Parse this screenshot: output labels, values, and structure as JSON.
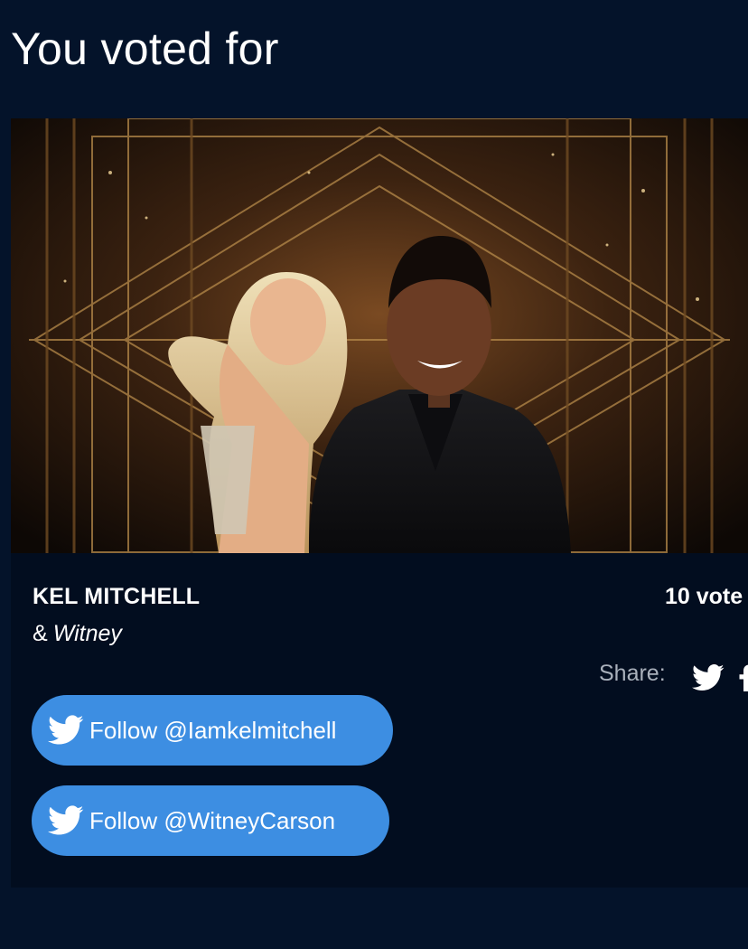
{
  "heading": "You voted for",
  "couple": {
    "celebrity_name": "KEL MITCHELL",
    "amp": "&",
    "partner_name": "Witney",
    "votes_label": "10 vote"
  },
  "share": {
    "label": "Share:",
    "icons": [
      "twitter-icon",
      "facebook-icon"
    ]
  },
  "follow_buttons": [
    {
      "label": "Follow @Iamkelmitchell",
      "icon": "twitter-icon"
    },
    {
      "label": "Follow @WitneyCarson",
      "icon": "twitter-icon"
    }
  ],
  "colors": {
    "background": "#04132a",
    "card": "#020d1f",
    "button": "#3d8ee2",
    "share_text": "#a9b0bb"
  }
}
